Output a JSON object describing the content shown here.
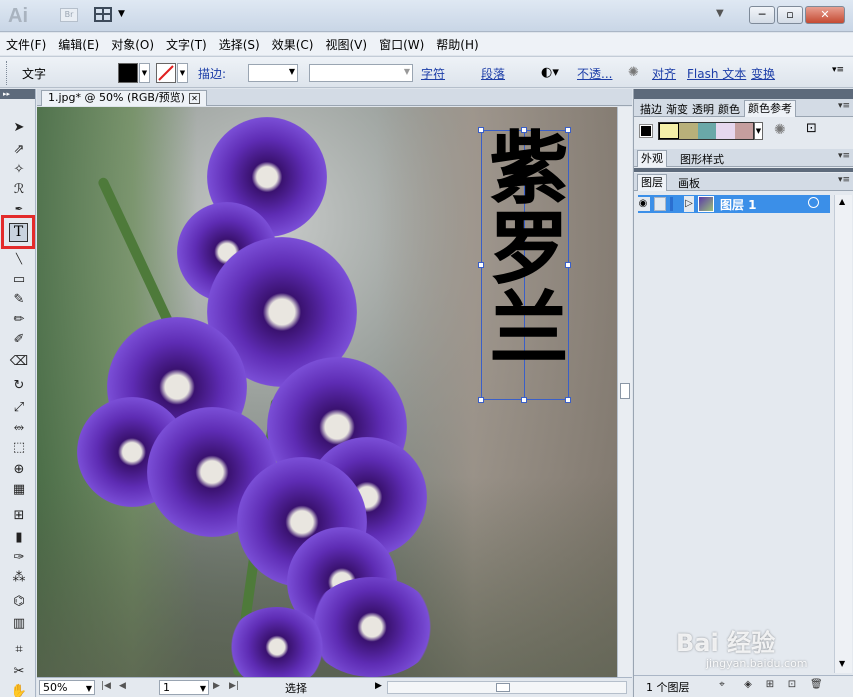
{
  "titlebar": {
    "app_logo": "Ai",
    "bridge_label": "Br",
    "extra": "▼"
  },
  "menu": [
    "文件(F)",
    "编辑(E)",
    "对象(O)",
    "文字(T)",
    "选择(S)",
    "效果(C)",
    "视图(V)",
    "窗口(W)",
    "帮助(H)"
  ],
  "control": {
    "tool_label": "文字",
    "stroke_label": "描边:",
    "char_link": "字符",
    "para_link": "段落",
    "opacity_link": "不透...",
    "align_link": "对齐",
    "flash_link": "Flash 文本",
    "transform_link": "变换",
    "fill_color": "#000000"
  },
  "document": {
    "tab_title": "1.jpg* @ 50% (RGB/预览)",
    "vertical_text": "紫罗兰"
  },
  "status": {
    "zoom": "50%",
    "page": "1",
    "label": "选择"
  },
  "panels": {
    "top_tabs": [
      "描边",
      "渐变",
      "透明",
      "颜色",
      "颜色参考"
    ],
    "mid_tabs": [
      "外观",
      "图形样式"
    ],
    "layer_tabs": [
      "图层",
      "画板"
    ],
    "layer_name": "图层 1",
    "layer_count": "1 个图层",
    "swatches": [
      "#f5f0a8",
      "#b8b07a",
      "#6aa8a8",
      "#e6d7ee",
      "#c59e9e"
    ]
  },
  "watermark": {
    "main": "Bai 经验",
    "sub": "jingyan.baidu.com"
  }
}
